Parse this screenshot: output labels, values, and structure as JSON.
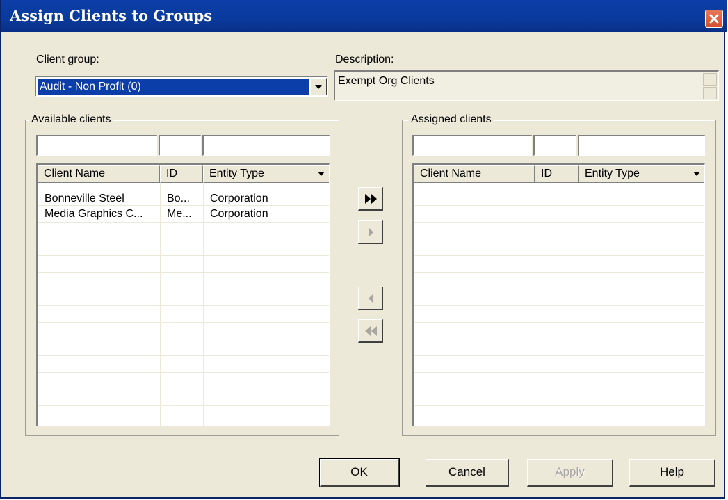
{
  "window": {
    "title": "Assign Clients to Groups"
  },
  "client_group": {
    "label": "Client group:",
    "selected": "Audit - Non Profit (0)"
  },
  "description": {
    "label": "Description:",
    "value": "Exempt Org Clients"
  },
  "available": {
    "legend": "Available clients",
    "columns": [
      "Client Name",
      "ID",
      "Entity Type"
    ],
    "rows": [
      {
        "name": "Bonneville Steel",
        "id": "Bo...",
        "type": "Corporation"
      },
      {
        "name": "Media Graphics C...",
        "id": "Me...",
        "type": "Corporation"
      }
    ]
  },
  "assigned": {
    "legend": "Assigned clients",
    "columns": [
      "Client Name",
      "ID",
      "Entity Type"
    ],
    "rows": []
  },
  "move_buttons": {
    "add_all": {
      "icon": "double-right-arrow-icon",
      "enabled": true
    },
    "add_one": {
      "icon": "right-arrow-icon",
      "enabled": false
    },
    "remove_one": {
      "icon": "left-arrow-icon",
      "enabled": false
    },
    "remove_all": {
      "icon": "double-left-arrow-icon",
      "enabled": false
    }
  },
  "buttons": {
    "ok": "OK",
    "cancel": "Cancel",
    "apply": "Apply",
    "help": "Help"
  },
  "colors": {
    "title_bar": "#0b3ea8",
    "dialog_bg": "#ece9d8",
    "selection": "#0b3ea8",
    "close_button": "#d2502f"
  }
}
